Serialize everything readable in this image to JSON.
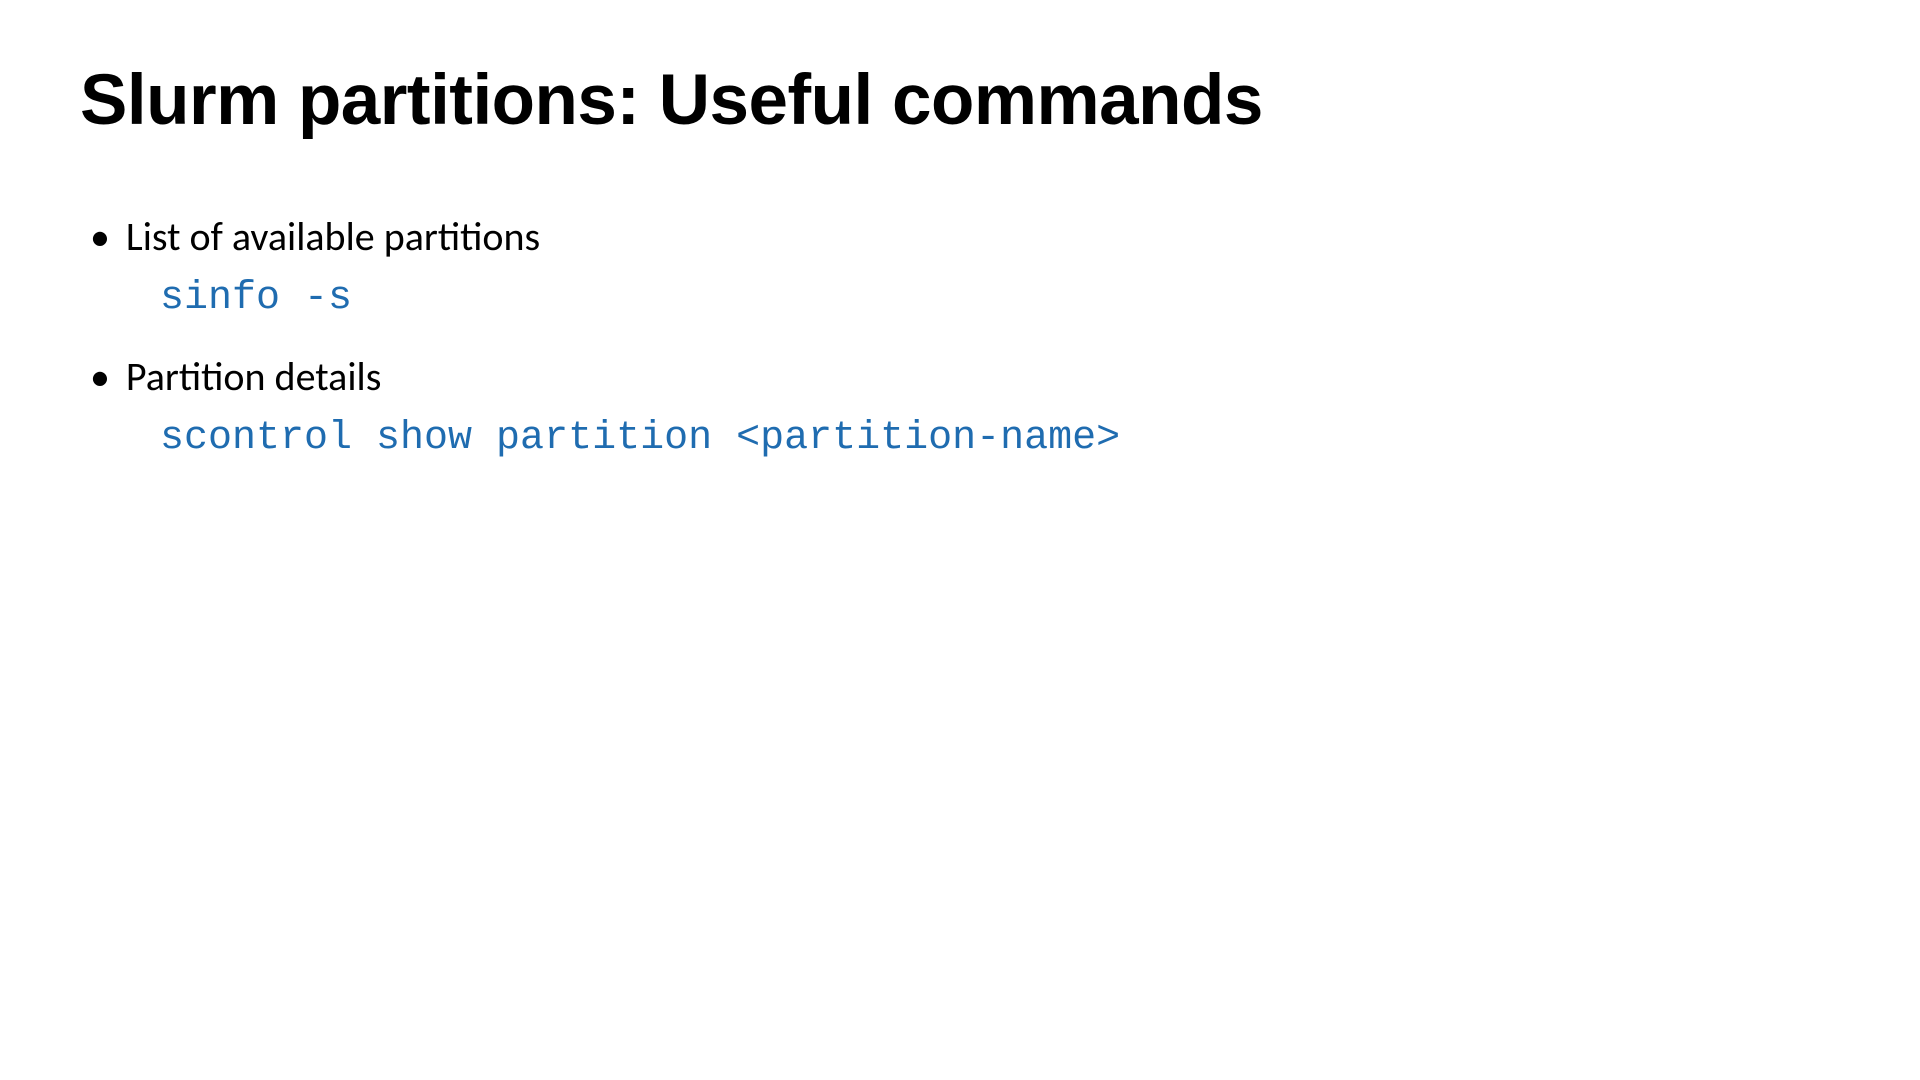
{
  "slide": {
    "title": "Slurm partitions: Useful commands",
    "items": [
      {
        "label": "List of available partitions",
        "command": "sinfo -s"
      },
      {
        "label": "Partition details",
        "command": "scontrol show partition <partition-name>"
      }
    ]
  }
}
